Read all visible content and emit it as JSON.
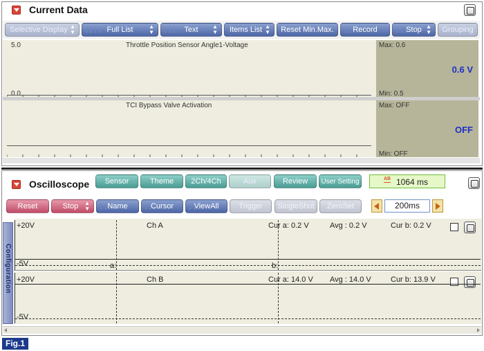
{
  "current_data": {
    "title": "Current Data",
    "toolbar": {
      "selective_display": "Selective Display",
      "full_list": "Full List",
      "text": "Text",
      "items_list": "Items List",
      "reset_minmax": "Reset Min.Max.",
      "record": "Record",
      "stop": "Stop",
      "grouping": "Grouping"
    },
    "items": [
      {
        "name": "Throttle Position Sensor Angle1-Voltage",
        "scale_max": "5.0",
        "scale_min": "0.0",
        "max_label": "Max: 0.6",
        "min_label": "Min: 0.5",
        "value": "0.6 V"
      },
      {
        "name": "TCI Bypass Valve Activation",
        "max_label": "Max: OFF",
        "min_label": "Min: OFF",
        "value": "OFF"
      }
    ]
  },
  "oscilloscope": {
    "title": "Oscilloscope",
    "top_buttons": {
      "sensor": "Sensor",
      "theme": "Theme",
      "ch_mode": "2Ch/4Ch",
      "aux": "Aux",
      "review": "Review",
      "user_setting": "User Setting"
    },
    "time_readout": "1064 ms",
    "time_icon_label": "AB",
    "bottom_buttons": {
      "reset": "Reset",
      "stop": "Stop",
      "name": "Name",
      "cursor": "Cursor",
      "view_all": "ViewAll",
      "trigger": "Trigger",
      "single_shot": "SingleShot",
      "zero_set": "ZeroSet"
    },
    "time_div": "200ms",
    "config_tab": "Configuration",
    "channels": [
      {
        "name": "Ch A",
        "top_scale": "+20V",
        "bottom_scale": "-5V",
        "cur_a": "Cur a: 0.2 V",
        "avg": "Avg  : 0.2 V",
        "cur_b": "Cur b: 0.2 V",
        "cursor_a": "a:",
        "cursor_b": "b:"
      },
      {
        "name": "Ch B",
        "top_scale": "+20V",
        "bottom_scale": "-5V",
        "cur_a": "Cur a: 14.0 V",
        "avg": "Avg  : 14.0 V",
        "cur_b": "Cur b: 13.9 V"
      }
    ]
  },
  "figure_label": "Fig.1",
  "colors": {
    "accent_value": "#1d2fc7",
    "panel_bg": "#eeeddf",
    "side_bg": "#b6b599",
    "readout_bg": "#e6f7c8",
    "readout_border": "#6fc03a"
  }
}
